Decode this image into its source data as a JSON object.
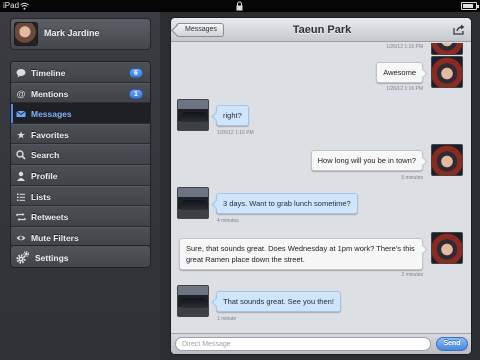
{
  "status_bar": {
    "carrier": "iPad",
    "battery_level": 0.8
  },
  "sidebar": {
    "account_name": "Mark Jardine",
    "items": [
      {
        "label": "Timeline",
        "icon": "speech-bubble-icon",
        "badge": "6"
      },
      {
        "label": "Mentions",
        "icon": "at-sign-icon",
        "badge": "1"
      },
      {
        "label": "Messages",
        "icon": "envelope-icon",
        "badge": "",
        "selected": true
      },
      {
        "label": "Favorites",
        "icon": "star-icon",
        "badge": ""
      },
      {
        "label": "Search",
        "icon": "magnifier-icon",
        "badge": ""
      },
      {
        "label": "Profile",
        "icon": "person-icon",
        "badge": ""
      },
      {
        "label": "Lists",
        "icon": "list-icon",
        "badge": ""
      },
      {
        "label": "Retweets",
        "icon": "retweet-icon",
        "badge": ""
      },
      {
        "label": "Mute Filters",
        "icon": "eye-icon",
        "badge": ""
      }
    ],
    "settings_label": "Settings",
    "accent_color": "#4d8fe6"
  },
  "conversation": {
    "back_label": "Messages",
    "title": "Taeun Park",
    "messages": [
      {
        "from": "me",
        "text": "",
        "timestamp": "1/26/12 1:16 PM"
      },
      {
        "from": "me",
        "text": "Awesome",
        "timestamp": "1/26/12 1:16 PM"
      },
      {
        "from": "them",
        "text": "right?",
        "timestamp": "1/26/12 1:16 PM"
      },
      {
        "from": "me",
        "text": "How long will you be in town?",
        "timestamp": "5 minutes"
      },
      {
        "from": "them",
        "text": "3 days. Want to grab lunch sometime?",
        "timestamp": "4 minutes"
      },
      {
        "from": "me",
        "text": "Sure, that sounds great. Does Wednesday at 1pm work? There's this great Ramen place down the street.",
        "timestamp": "2 minutes"
      },
      {
        "from": "them",
        "text": "That sounds great. See you then!",
        "timestamp": "1 minute"
      }
    ],
    "composer": {
      "placeholder": "Direct Message",
      "value": "",
      "send_label": "Send"
    }
  }
}
